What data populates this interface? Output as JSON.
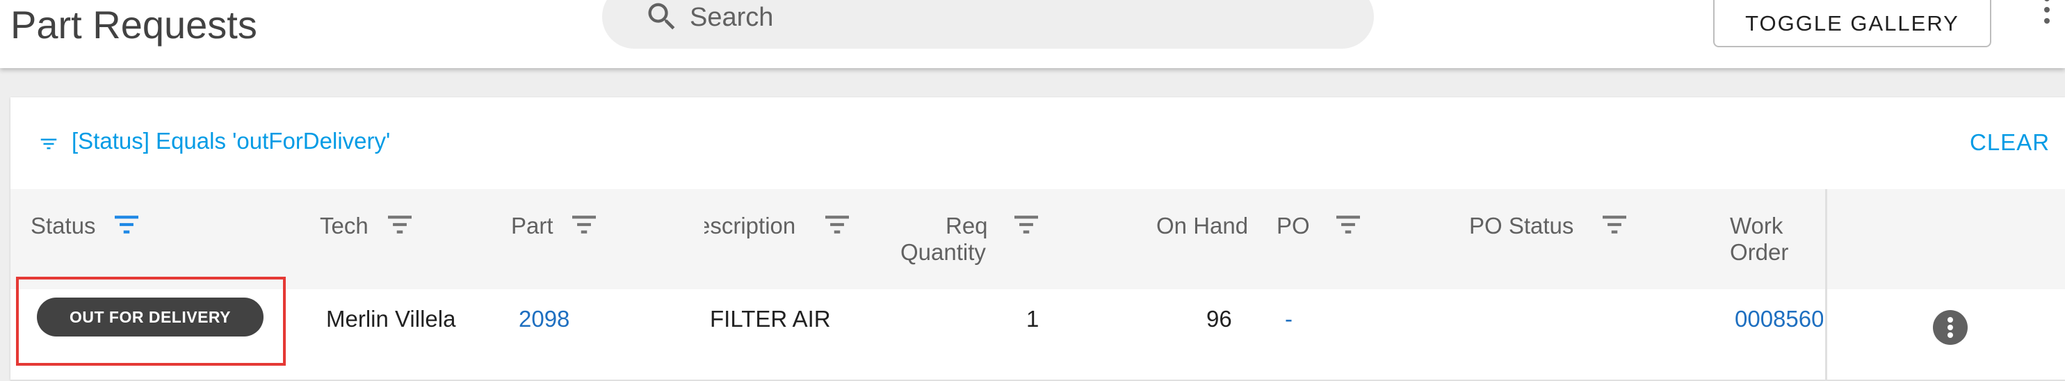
{
  "header": {
    "title": "Part Requests",
    "search": {
      "placeholder": "Search",
      "value": ""
    },
    "toggle_gallery_label": "TOGGLE GALLERY"
  },
  "filter": {
    "text": "[Status] Equals 'outForDelivery'",
    "clear_label": "CLEAR"
  },
  "table": {
    "columns": [
      {
        "key": "status",
        "label": "Status",
        "filter_active": true
      },
      {
        "key": "tech",
        "label": "Tech",
        "filter_active": false
      },
      {
        "key": "part",
        "label": "Part",
        "filter_active": false
      },
      {
        "key": "description",
        "label": "escription",
        "filter_active": false
      },
      {
        "key": "req_quantity",
        "label_line1": "Req",
        "label_line2": "Quantity",
        "filter_active": false
      },
      {
        "key": "on_hand",
        "label": "On Hand"
      },
      {
        "key": "po",
        "label": "PO",
        "filter_active": false
      },
      {
        "key": "po_status",
        "label": "PO Status",
        "filter_active": false
      },
      {
        "key": "work_order",
        "label_line1": "Work",
        "label_line2": "Order"
      }
    ],
    "rows": [
      {
        "status": "OUT FOR DELIVERY",
        "tech": "Merlin Villela",
        "part": "2098",
        "description": "FILTER AIR",
        "req_quantity": "1",
        "on_hand": "96",
        "po": "-",
        "po_status": "",
        "work_order": "0008560"
      }
    ]
  },
  "colors": {
    "accent": "#039be5",
    "link": "#1e6fc0",
    "chip_bg": "#424242",
    "highlight_outline": "#e53935"
  },
  "icons": {
    "search": "search-icon",
    "filter": "filter-icon",
    "column_filter": "filter-list-icon",
    "menu": "more-vert-icon"
  }
}
